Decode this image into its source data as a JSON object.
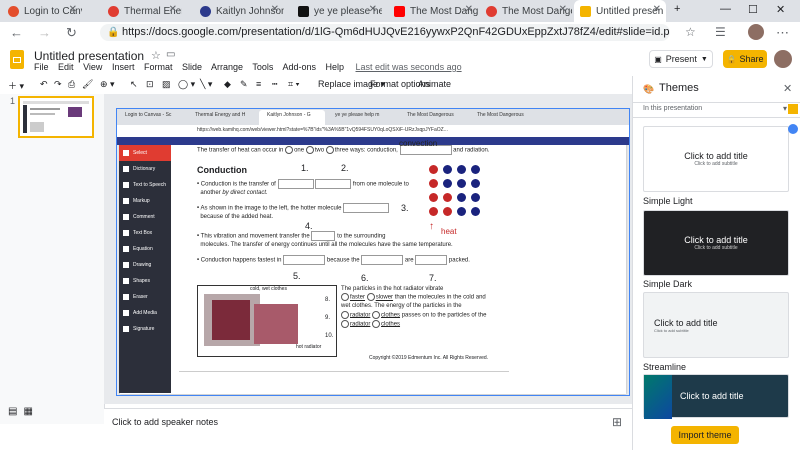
{
  "browser": {
    "tabs": [
      {
        "title": "Login to Canvas",
        "color": "#e34e2c",
        "active": false
      },
      {
        "title": "Thermal Energy",
        "color": "#e03c31",
        "active": false
      },
      {
        "title": "Kaitlyn Johnson",
        "color": "#2c3a8c",
        "active": false
      },
      {
        "title": "ye ye please he",
        "color": "#111111",
        "active": false
      },
      {
        "title": "The Most Dange",
        "color": "#ff0000",
        "active": false
      },
      {
        "title": "The Most Dange",
        "color": "#e03c31",
        "active": false
      },
      {
        "title": "Untitled presen",
        "color": "#f4b400",
        "active": true
      }
    ],
    "new_tab": "+",
    "url": "https://docs.google.com/presentation/d/1lG-Qm6dHUJQvE216yywxP2QnF42GDUxEppZxtJ78fZ4/edit#slide=id.p"
  },
  "app": {
    "title": "Untitled presentation",
    "menu": [
      "File",
      "Edit",
      "View",
      "Insert",
      "Format",
      "Slide",
      "Arrange",
      "Tools",
      "Add-ons",
      "Help"
    ],
    "last_edit": "Last edit was seconds ago",
    "present": "Present",
    "share": "Share",
    "toolbar_items": [
      "Replace image",
      "Format options",
      "Animate"
    ]
  },
  "filmstrip": {
    "slide_number": "1"
  },
  "embedded": {
    "tabs": [
      "Login to Canvas - Sc",
      "Thermal Energy and H",
      "Kaitlyn Johnson - G",
      "ye ye please help m",
      "The Most Dangerous",
      "The Most Dangerous"
    ],
    "url": "https://web.kamihq.com/web/viewer.html?state=%7B\"ids\"%3A%5B\"1vQ594FSUY0qLoQSXiF-URzJsqpJYFaOZ...",
    "sidebar": [
      "Select",
      "Dictionary",
      "Text to Speech",
      "Markup",
      "Comment",
      "Text Box",
      "Equation",
      "Drawing",
      "Shapes",
      "Eraser",
      "Add Media",
      "Signature"
    ],
    "doc": {
      "intro": "The transfer of heat can occur in",
      "intro_opts": [
        "one",
        "two",
        "three"
      ],
      "intro_end": "ways: conduction,",
      "conv": "convection",
      "radiation": "and radiation.",
      "heading": "Conduction",
      "num1": "1.",
      "num2": "2.",
      "num3": "3.",
      "num4": "4.",
      "num5": "5.",
      "num6": "6.",
      "num7": "7.",
      "num8": "8.",
      "num9": "9.",
      "num10": "10.",
      "b1a": "Conduction is the transfer of",
      "b1b": "from one molecule to",
      "b1c": "another",
      "b1d": "by direct contact.",
      "b2a": "As shown in the image to the left, the hotter molecule",
      "b2b": "because of the added heat.",
      "b3a": "This vibration and movement transfer the",
      "b3b": "to the surrounding",
      "b3c": "molecules. The transfer of energy continues until all the molecules have the same temperature.",
      "b4a": "Conduction happens fastest in",
      "b4b": "because the",
      "b4c": "are",
      "b4d": "packed.",
      "heat": "heat",
      "img_top": "cold, wet clothes",
      "img_bottom": "hot radiator",
      "p1": "The particles in the hot radiator vibrate",
      "faster": "faster",
      "slower": "slower",
      "p2": "than the molecules in the cold and",
      "p3": "wet clothes. The energy of the particles in the",
      "radiator": "radiator",
      "clothes": "clothes",
      "p4": "passes on to the particles of the",
      "copyright": "Copyright ©2019 Edmentum Inc. All Rights Reserved."
    }
  },
  "notes": "Click to add speaker notes",
  "themes": {
    "title": "Themes",
    "section": "In this presentation",
    "items": [
      {
        "name": "Simple Light",
        "title": "Click to add title",
        "subtitle": "Click to add subtitle"
      },
      {
        "name": "Simple Dark",
        "title": "Click to add title",
        "subtitle": "Click to add subtitle"
      },
      {
        "name": "Streamline",
        "title": "Click to add title",
        "subtitle": "Click to add subtitle"
      },
      {
        "name": "",
        "title": "Click to add title",
        "subtitle": ""
      }
    ],
    "import": "Import theme"
  }
}
